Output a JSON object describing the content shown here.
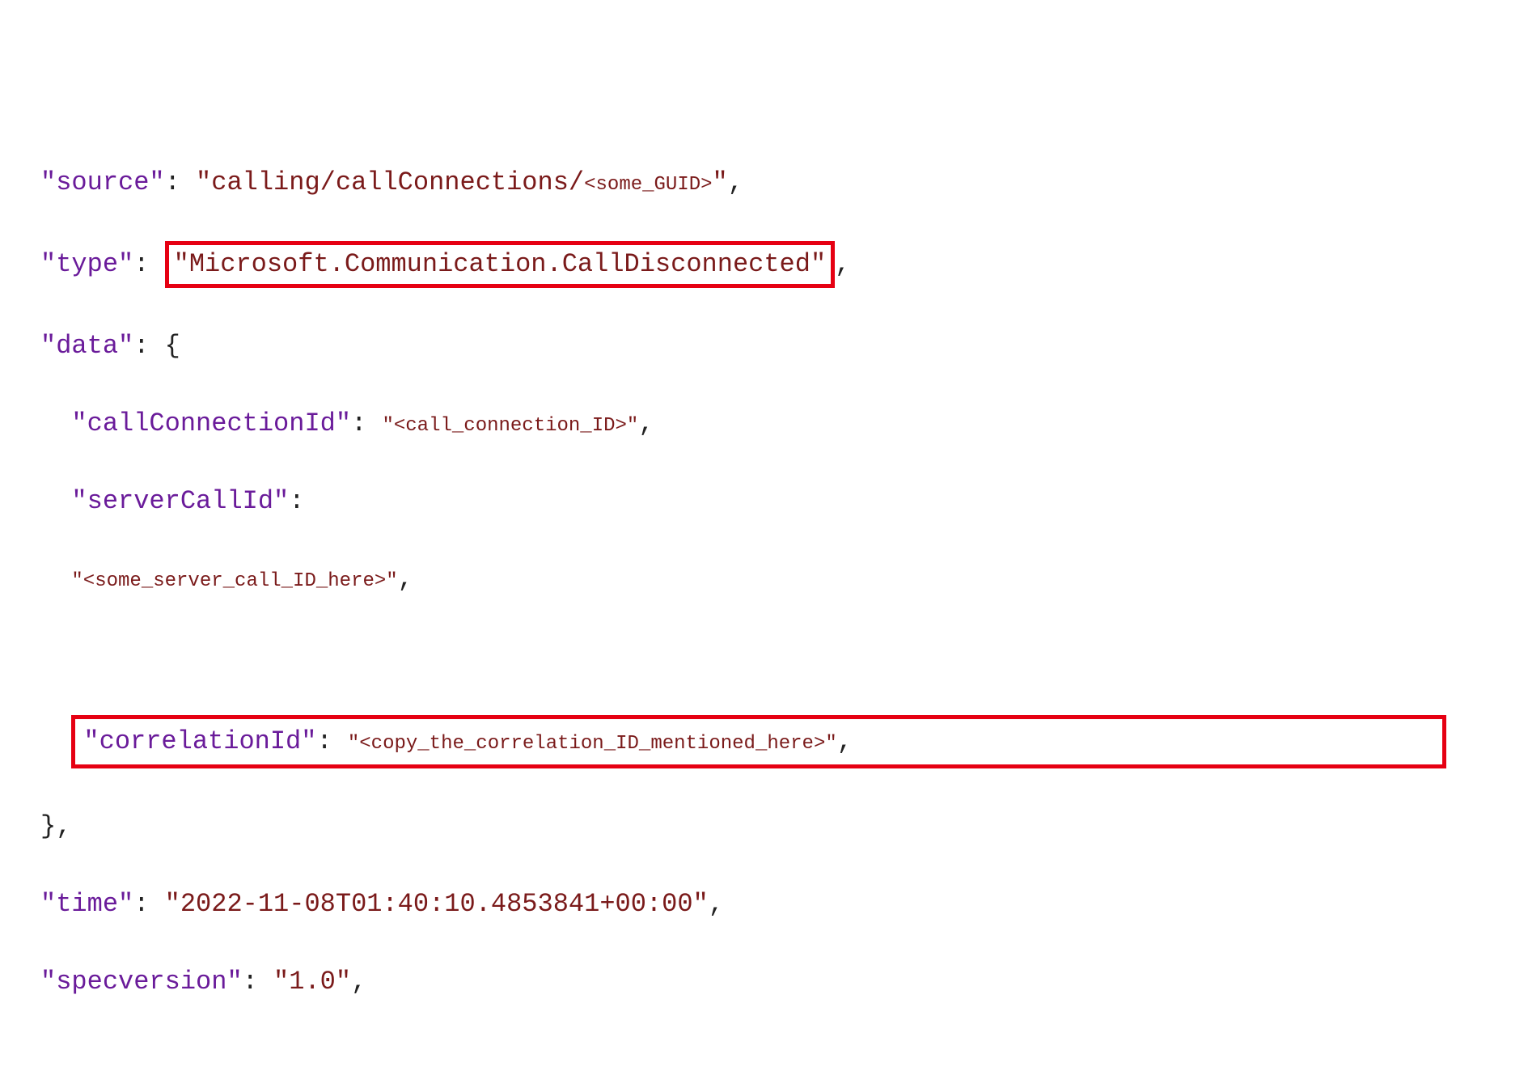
{
  "code": {
    "source": {
      "key": "\"source\"",
      "colon": ": ",
      "valPrefix": "\"calling/callConnections/",
      "valPlaceholder": "<some_GUID>",
      "valSuffix": "\"",
      "comma": ","
    },
    "type": {
      "key": "\"type\"",
      "colon": ": ",
      "val": "\"Microsoft.Communication.CallDisconnected\"",
      "comma": ","
    },
    "data": {
      "key": "\"data\"",
      "colon": ": ",
      "open": "{",
      "close": "}",
      "comma": ","
    },
    "callConnectionId": {
      "key": "\"callConnectionId\"",
      "colon": ": ",
      "val": "\"<call_connection_ID>\"",
      "comma": ","
    },
    "serverCallId": {
      "key": "\"serverCallId\"",
      "colon": ":",
      "val": "\"<some_server_call_ID_here>\"",
      "comma": ","
    },
    "correlationId": {
      "key": "\"correlationId\"",
      "colon": ": ",
      "val": "\"<copy_the_correlation_ID_mentioned_here>\"",
      "comma": ","
    },
    "time": {
      "key": "\"time\"",
      "colon": ": ",
      "val": "\"2022-11-08T01:40:10.4853841+00:00\"",
      "comma": ","
    },
    "specversion": {
      "key": "\"specversion\"",
      "colon": ": ",
      "val": "\"1.0\"",
      "comma": ","
    }
  }
}
